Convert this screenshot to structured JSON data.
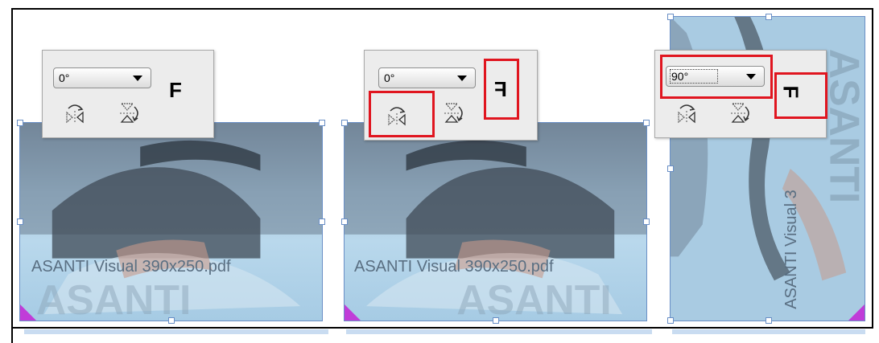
{
  "panels": [
    {
      "angle": "0°",
      "letter": "F"
    },
    {
      "angle": "0°",
      "letter": "F"
    },
    {
      "angle": "90°",
      "letter": "F"
    }
  ],
  "cards": [
    {
      "label": "ASANTI Visual 390x250.pdf"
    },
    {
      "label": "ASANTI Visual 390x250.pdf"
    },
    {
      "label": "ASANTI Visual 3"
    }
  ],
  "icons": {
    "flip_horizontal": "flip-horizontal-icon",
    "flip_vertical": "flip-vertical-icon"
  },
  "colors": {
    "highlight": "#e0151f",
    "selection": "#6a8fc6",
    "corner_marker": "#c03cd8"
  }
}
